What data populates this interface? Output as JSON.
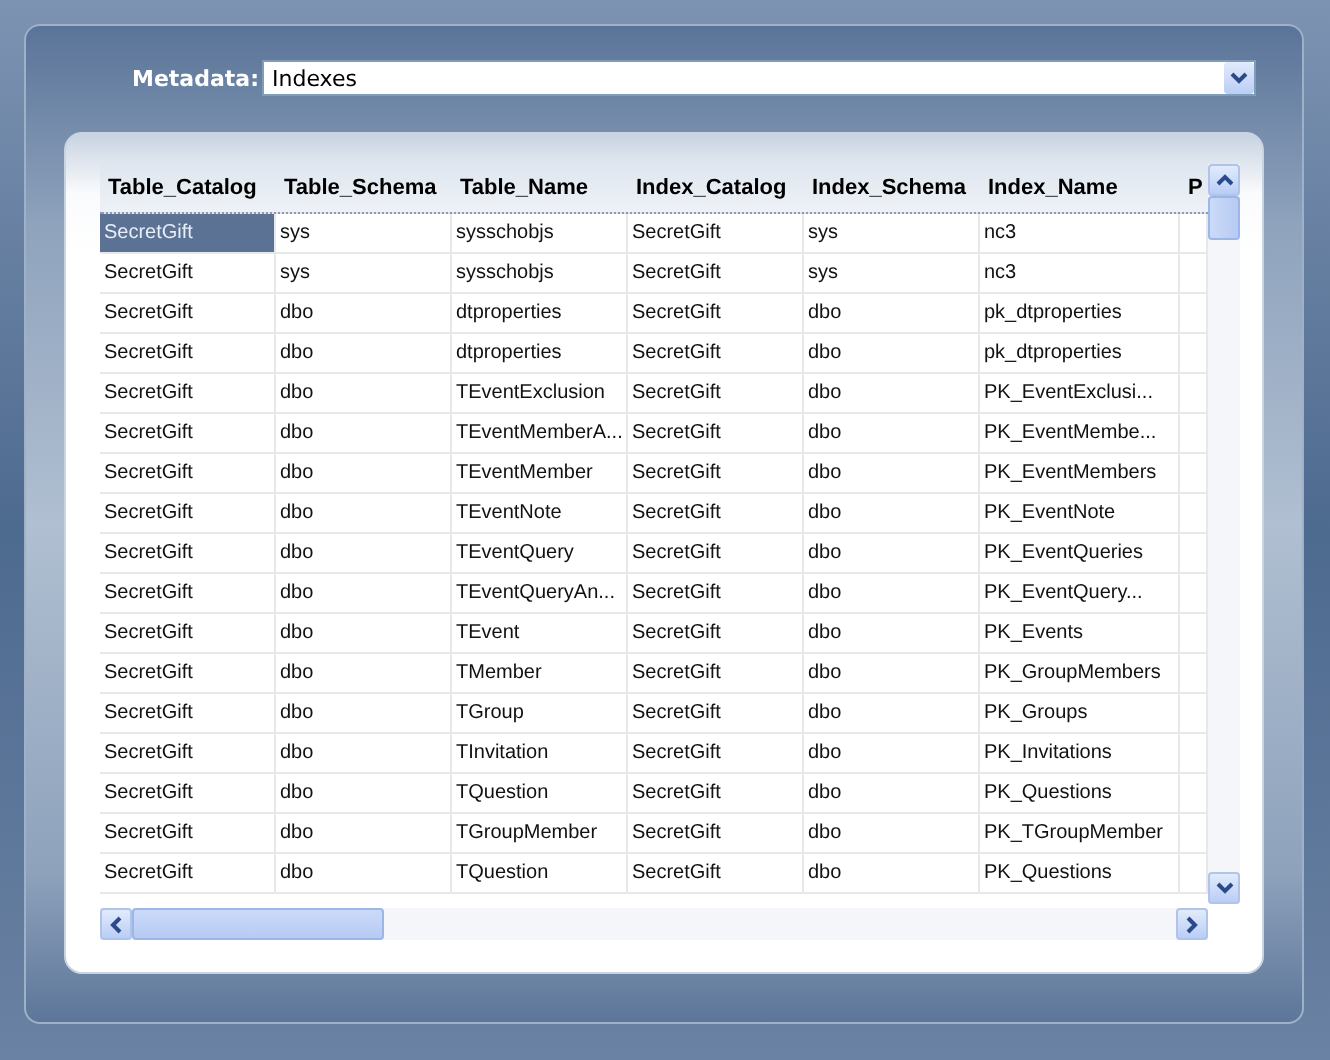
{
  "metadata": {
    "label": "Metadata:",
    "value": "Indexes"
  },
  "table": {
    "columns": [
      "Table_Catalog",
      "Table_Schema",
      "Table_Name",
      "Index_Catalog",
      "Index_Schema",
      "Index_Name",
      "P"
    ],
    "rows": [
      {
        "selected": true,
        "cells": [
          "SecretGift",
          "sys",
          "sysschobjs",
          "SecretGift",
          "sys",
          "nc3"
        ]
      },
      {
        "selected": false,
        "cells": [
          "SecretGift",
          "sys",
          "sysschobjs",
          "SecretGift",
          "sys",
          "nc3"
        ]
      },
      {
        "selected": false,
        "cells": [
          "SecretGift",
          "dbo",
          "dtproperties",
          "SecretGift",
          "dbo",
          "pk_dtproperties"
        ]
      },
      {
        "selected": false,
        "cells": [
          "SecretGift",
          "dbo",
          "dtproperties",
          "SecretGift",
          "dbo",
          "pk_dtproperties"
        ]
      },
      {
        "selected": false,
        "cells": [
          "SecretGift",
          "dbo",
          "TEventExclusion",
          "SecretGift",
          "dbo",
          "PK_EventExclusi..."
        ]
      },
      {
        "selected": false,
        "cells": [
          "SecretGift",
          "dbo",
          "TEventMemberA...",
          "SecretGift",
          "dbo",
          "PK_EventMembe..."
        ]
      },
      {
        "selected": false,
        "cells": [
          "SecretGift",
          "dbo",
          "TEventMember",
          "SecretGift",
          "dbo",
          "PK_EventMembers"
        ]
      },
      {
        "selected": false,
        "cells": [
          "SecretGift",
          "dbo",
          "TEventNote",
          "SecretGift",
          "dbo",
          "PK_EventNote"
        ]
      },
      {
        "selected": false,
        "cells": [
          "SecretGift",
          "dbo",
          "TEventQuery",
          "SecretGift",
          "dbo",
          "PK_EventQueries"
        ]
      },
      {
        "selected": false,
        "cells": [
          "SecretGift",
          "dbo",
          "TEventQueryAn...",
          "SecretGift",
          "dbo",
          "PK_EventQuery..."
        ]
      },
      {
        "selected": false,
        "cells": [
          "SecretGift",
          "dbo",
          "TEvent",
          "SecretGift",
          "dbo",
          "PK_Events"
        ]
      },
      {
        "selected": false,
        "cells": [
          "SecretGift",
          "dbo",
          "TMember",
          "SecretGift",
          "dbo",
          "PK_GroupMembers"
        ]
      },
      {
        "selected": false,
        "cells": [
          "SecretGift",
          "dbo",
          "TGroup",
          "SecretGift",
          "dbo",
          "PK_Groups"
        ]
      },
      {
        "selected": false,
        "cells": [
          "SecretGift",
          "dbo",
          "TInvitation",
          "SecretGift",
          "dbo",
          "PK_Invitations"
        ]
      },
      {
        "selected": false,
        "cells": [
          "SecretGift",
          "dbo",
          "TQuestion",
          "SecretGift",
          "dbo",
          "PK_Questions"
        ]
      },
      {
        "selected": false,
        "cells": [
          "SecretGift",
          "dbo",
          "TGroupMember",
          "SecretGift",
          "dbo",
          "PK_TGroupMember"
        ]
      },
      {
        "selected": false,
        "cells": [
          "SecretGift",
          "dbo",
          "TQuestion",
          "SecretGift",
          "dbo",
          "PK_Questions"
        ]
      }
    ]
  }
}
